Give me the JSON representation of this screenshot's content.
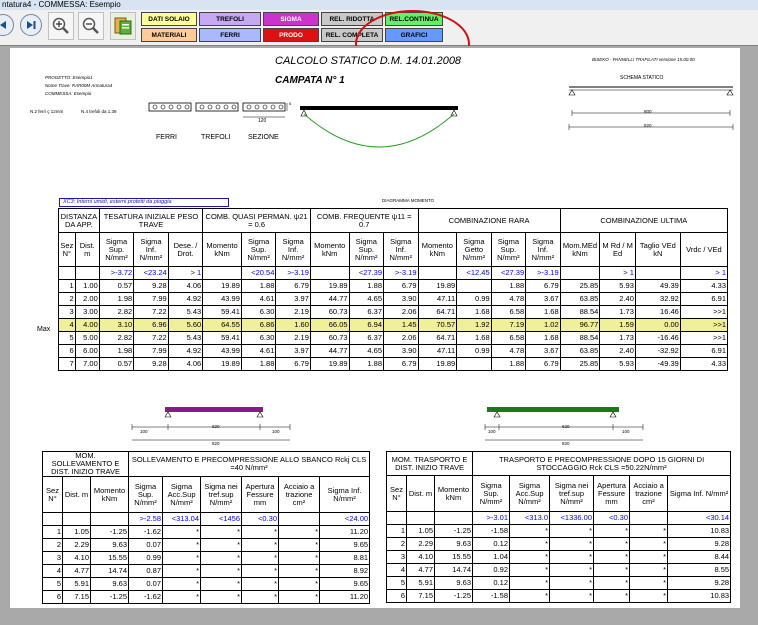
{
  "window": {
    "title": "ntatura4 - COMMESSA: Esempio"
  },
  "toolbar": {
    "buttons": [
      {
        "label": "DATI SOLAIO",
        "color": "#ffff99"
      },
      {
        "label": "MATERIALI",
        "color": "#ffcc99"
      },
      {
        "label": "TREFOLI",
        "color": "#c7a8f2"
      },
      {
        "label": "FERRI",
        "color": "#aab8ff"
      },
      {
        "label": "SIGMA",
        "color": "#cc33cc"
      },
      {
        "label": "PRODO",
        "color": "#dd1111"
      },
      {
        "label": "REL. RIDOTTA",
        "color": "#c8c8c8"
      },
      {
        "label": "REL. COMPLETA",
        "color": "#c8c8c8"
      },
      {
        "label": "REL.CONTINUA",
        "color": "#66ee66"
      },
      {
        "label": "GRAFICI",
        "color": "#6699ff"
      }
    ]
  },
  "report": {
    "title": "CALCOLO STATICO D.M. 14.01.2008",
    "software": "BISEKO - PANNELLI TRAFILATI versione 15.00.00",
    "campata": "CAMPATA N° 1",
    "schema_label": "SCHEMA STATICO",
    "progetto": "PROGETTO: Esempio1",
    "nome_trave": "Nome Trave: RAR00M Armatura4",
    "commessa": "COMMESSA: Esempio",
    "ferri_info": "N.2 ferri ç 12mm",
    "trefoli_info": "N.4 trefoli da 1.39",
    "sez_width": "120",
    "sez_height": "5",
    "label_ferri": "FERRI",
    "label_trefoli": "TREFOLI",
    "label_sezione": "SEZIONE",
    "diagram_label": "DIAGRAMMA MOMENTO",
    "schema_800": "800",
    "schema_820": "820",
    "xc3_note": "XC3: Interni umidi, esterni protetti da pioggia"
  },
  "main_table": {
    "groups": [
      "DISTANZA DA APP.",
      "TESATURA INIZIALE PESO TRAVE",
      "COMB. QUASI PERMAN. ψ21 = 0.6",
      "COMB. FREQUENTE ψ11 = 0.7",
      "COMBINAZIONE RARA",
      "COMBINAZIONE ULTIMA"
    ],
    "headers": [
      "Sez N°",
      "Dist. m",
      "Sigma Sup. N/mm²",
      "Sigma Inf. N/mm²",
      "Dese. / Drot.",
      "Momento kNm",
      "Sigma Sup. N/mm²",
      "Sigma Inf. N/mm²",
      "Momento kNm",
      "Sigma Sup. N/mm²",
      "Sigma Inf. N/mm²",
      "Momento kNm",
      "Sigma Getto N/mm²",
      "Sigma Sup. N/mm²",
      "Sigma Inf. N/mm²",
      "Mom.MEd kNm",
      "M Rd / M Ed",
      "Taglio VEd kN",
      "Vrdc / VEd"
    ],
    "limits": [
      "",
      "",
      ">-3.72",
      "<23.24",
      "> 1",
      "",
      "<20.54",
      ">-3.19",
      "",
      "<27.39",
      ">-3.19",
      "",
      "<12.45",
      "<27.39",
      ">-3.19",
      "",
      "> 1",
      "",
      "> 1"
    ],
    "max_label": "Max",
    "rows": [
      [
        "1",
        "1.00",
        "0.57",
        "9.28",
        "4.06",
        "19.89",
        "1.88",
        "6.79",
        "19.89",
        "1.88",
        "6.79",
        "19.89",
        "",
        "1.88",
        "6.79",
        "25.85",
        "5.93",
        "49.39",
        "4.33"
      ],
      [
        "2",
        "2.00",
        "1.98",
        "7.99",
        "4.92",
        "43.99",
        "4.61",
        "3.97",
        "44.77",
        "4.65",
        "3.90",
        "47.11",
        "0.99",
        "4.78",
        "3.67",
        "63.85",
        "2.40",
        "32.92",
        "6.91"
      ],
      [
        "3",
        "3.00",
        "2.82",
        "7.22",
        "5.43",
        "59.41",
        "6.30",
        "2.19",
        "60.73",
        "6.37",
        "2.06",
        "64.71",
        "1.68",
        "6.58",
        "1.68",
        "88.54",
        "1.73",
        "16.46",
        ">>1"
      ],
      [
        "4",
        "4.00",
        "3.10",
        "6.96",
        "5.60",
        "64.55",
        "6.86",
        "1.60",
        "66.05",
        "6.94",
        "1.45",
        "70.57",
        "1.92",
        "7.19",
        "1.02",
        "96.77",
        "1.59",
        "0.00",
        ">>1"
      ],
      [
        "5",
        "5.00",
        "2.82",
        "7.22",
        "5.43",
        "59.41",
        "6.30",
        "2.19",
        "60.73",
        "6.37",
        "2.06",
        "64.71",
        "1.68",
        "6.58",
        "1.68",
        "88.54",
        "1.73",
        "-16.46",
        ">>1"
      ],
      [
        "6",
        "6.00",
        "1.98",
        "7.99",
        "4.92",
        "43.99",
        "4.61",
        "3.97",
        "44.77",
        "4.65",
        "3.90",
        "47.11",
        "0.99",
        "4.78",
        "3.67",
        "63.85",
        "2.40",
        "-32.92",
        "6.91"
      ],
      [
        "7",
        "7.00",
        "0.57",
        "9.28",
        "4.06",
        "19.89",
        "1.88",
        "6.79",
        "19.89",
        "1.88",
        "6.79",
        "19.89",
        "",
        "1.88",
        "6.79",
        "25.85",
        "5.93",
        "-49.39",
        "4.33"
      ]
    ]
  },
  "lift": {
    "label": "SOLLEVAMENTO",
    "dims": [
      "100",
      "620",
      "100",
      "820"
    ],
    "group1": "MOM. SOLLEVAMENTO E DIST. INIZIO TRAVE",
    "group2": "SOLLEVAMENTO E PRECOMPRESSIONE ALLO SBANCO Rckj CLS =40 N/mm²",
    "headers": [
      "Sez N°",
      "Dist. m",
      "Momento kNm",
      "Sigma Sup. N/mm²",
      "Sigma Acc.Sup N/mm²",
      "Sigma nei tref.sup N/mm²",
      "Apertura Fessure mm",
      "Acciaio a trazione cm²",
      "Sigma Inf. N/mm²"
    ],
    "limits": [
      "",
      "",
      "",
      ">-2.58",
      "<313.04",
      "<1456",
      "<0.30",
      "",
      "<24.00"
    ],
    "rows": [
      [
        "1",
        "1.05",
        "-1.25",
        "-1.62",
        "*",
        "*",
        "*",
        "*",
        "11.20"
      ],
      [
        "2",
        "2.29",
        "9.63",
        "0.07",
        "*",
        "*",
        "*",
        "*",
        "9.65"
      ],
      [
        "3",
        "4.10",
        "15.55",
        "0.99",
        "*",
        "*",
        "*",
        "*",
        "8.81"
      ],
      [
        "4",
        "4.77",
        "14.74",
        "0.87",
        "*",
        "*",
        "*",
        "*",
        "8.92"
      ],
      [
        "5",
        "5.91",
        "9.63",
        "0.07",
        "*",
        "*",
        "*",
        "*",
        "9.65"
      ],
      [
        "6",
        "7.15",
        "-1.25",
        "-1.62",
        "*",
        "*",
        "*",
        "*",
        "11.20"
      ]
    ]
  },
  "transport": {
    "label": "TRASPORTO",
    "dims": [
      "100",
      "620",
      "100",
      "820"
    ],
    "group1": "MOM. TRASPORTO E DIST. INIZIO TRAVE",
    "group2": "TRASPORTO E PRECOMPRESSIONE DOPO 15 GIORNI DI STOCCAGGIO Rck CLS =50.22N/mm²",
    "headers": [
      "Sez N°",
      "Dist. m",
      "Momento kNm",
      "Sigma Sup. N/mm²",
      "Sigma Acc.Sup N/mm²",
      "Sigma nei tref.sup N/mm²",
      "Apertura Fessure mm",
      "Acciaio a trazione cm²",
      "Sigma Inf. N/mm²"
    ],
    "limits": [
      "",
      "",
      "",
      ">-3.01",
      "<313.0",
      "<1336.00",
      "<0.30",
      "",
      "<30.14"
    ],
    "rows": [
      [
        "1",
        "1.05",
        "-1.25",
        "-1.58",
        "*",
        "*",
        "*",
        "*",
        "10.83"
      ],
      [
        "2",
        "2.29",
        "9.63",
        "0.12",
        "*",
        "*",
        "*",
        "*",
        "9.28"
      ],
      [
        "3",
        "4.10",
        "15.55",
        "1.04",
        "*",
        "*",
        "*",
        "*",
        "8.44"
      ],
      [
        "4",
        "4.77",
        "14.74",
        "0.92",
        "*",
        "*",
        "*",
        "*",
        "8.55"
      ],
      [
        "5",
        "5.91",
        "9.63",
        "0.12",
        "*",
        "*",
        "*",
        "*",
        "9.28"
      ],
      [
        "6",
        "7.15",
        "-1.25",
        "-1.58",
        "*",
        "*",
        "*",
        "*",
        "10.83"
      ]
    ]
  }
}
